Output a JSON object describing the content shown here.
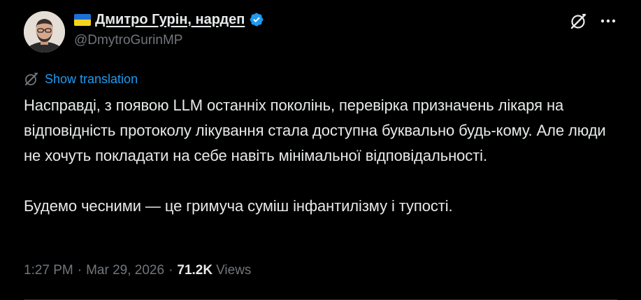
{
  "author": {
    "display_name": "Дмитро Гурін, нардеп",
    "handle": "@DmytroGurinMP",
    "flag": "ukraine-flag-icon",
    "verified_badge": "verified-badge-icon",
    "avatar": "author-avatar"
  },
  "actions": {
    "grok_icon": "grok-icon",
    "more_icon": "more-options-icon"
  },
  "translate": {
    "icon": "translate-icon",
    "label": "Show translation"
  },
  "tweet": {
    "paragraphs": [
      "Насправді, з появою LLM останніх поколінь, перевірка призначень лікаря на відповідність протоколу лікування стала доступна буквально будь-кому. Але люди не хочуть покладати на себе навіть мінімальної відповідальності.",
      "Будемо чесними — це гримуча суміш інфантилізму і тупості."
    ]
  },
  "meta": {
    "time": "1:27 PM",
    "separator": "·",
    "date": "Mar 29, 2026",
    "views_count": "71.2K",
    "views_label": "Views"
  },
  "colors": {
    "background": "#000000",
    "text_primary": "#e7e9ea",
    "text_secondary": "#71767b",
    "link": "#1d9bf0",
    "verified": "#1d9bf0"
  }
}
